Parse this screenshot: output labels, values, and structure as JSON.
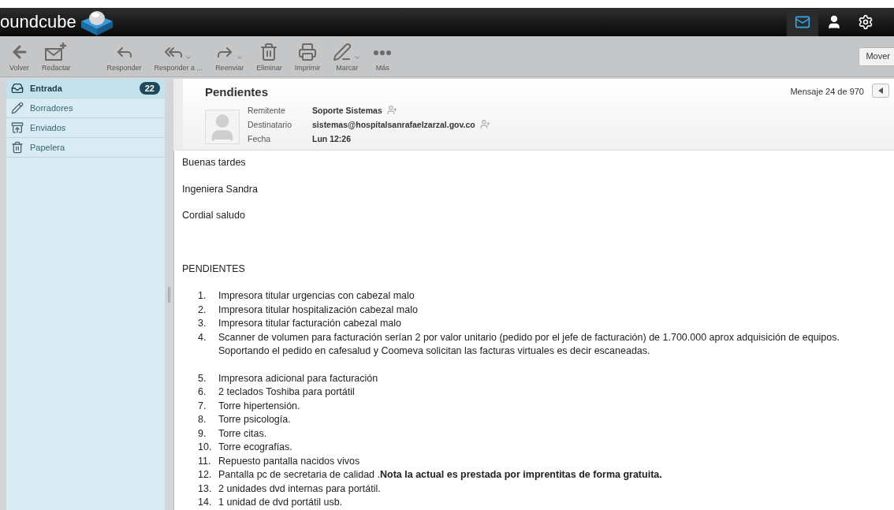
{
  "header": {
    "logo": "oundcube",
    "apps": [
      {
        "kind": "mail",
        "selected": true
      },
      {
        "kind": "contacts",
        "selected": false
      },
      {
        "kind": "settings",
        "selected": false
      }
    ]
  },
  "toolbar": {
    "buttons": [
      {
        "kind": "back",
        "label": "Volver",
        "menu": false
      },
      {
        "kind": "compose",
        "label": "Redactar",
        "menu": false
      },
      {
        "kind": "reply",
        "label": "Responder",
        "menu": false
      },
      {
        "kind": "reply-all",
        "label": "Responder a ...",
        "menu": true
      },
      {
        "kind": "forward",
        "label": "Reenviar",
        "menu": true
      },
      {
        "kind": "delete",
        "label": "Eliminar",
        "menu": false
      },
      {
        "kind": "print",
        "label": "Imprimir",
        "menu": false
      },
      {
        "kind": "mark",
        "label": "Marcar",
        "menu": true
      },
      {
        "kind": "more",
        "label": "Más",
        "menu": false
      }
    ],
    "move_button": "Mover"
  },
  "sidebar": {
    "folders": [
      {
        "kind": "inbox",
        "label": "Entrada",
        "count": "22",
        "selected": true
      },
      {
        "kind": "drafts",
        "label": "Borradores",
        "selected": false
      },
      {
        "kind": "sent",
        "label": "Enviados",
        "selected": false
      },
      {
        "kind": "trash",
        "label": "Papelera",
        "selected": false
      }
    ]
  },
  "message": {
    "subject": "Pendientes",
    "counter": "Mensaje 24 de 970",
    "fields": [
      {
        "label": "Remitente",
        "value": "Soporte Sistemas",
        "add_contact": true
      },
      {
        "label": "Destinatario",
        "value": "sistemas@hospitalsanrafaelzarzal.gov.co",
        "add_contact": true
      },
      {
        "label": "Fecha",
        "value": "Lun 12:26",
        "add_contact": false
      }
    ],
    "paragraphs": [
      "Buenas tardes",
      "Ingeniera Sandra",
      "Cordial saludo"
    ],
    "heading": "PENDIENTES",
    "list_1": [
      {
        "number": "1.",
        "text": "Impresora titular urgencias con cabezal malo"
      },
      {
        "number": "2.",
        "text": "Impresora titular hospitalización cabezal malo"
      },
      {
        "number": "3.",
        "text": "Impresora titular facturación cabezal malo"
      },
      {
        "number": "4.",
        "text": "Scanner de volumen para facturación serían 2 por valor unitario (pedido por el jefe de facturación) de 1.700.000 aprox adquisición de equipos. Soportando el pedido en cafesalud y Coomeva solicitan las facturas virtuales es decir escaneadas."
      }
    ],
    "list_2": [
      {
        "number": "5.",
        "text": "Impresora adicional para facturación"
      },
      {
        "number": "6.",
        "text": "2 teclados Toshiba para portátil"
      },
      {
        "number": "7.",
        "text": "Torre hipertensión."
      },
      {
        "number": "8.",
        "text": "Torre psicología."
      },
      {
        "number": "9.",
        "text": "Torre citas."
      },
      {
        "number": "10.",
        "text": "Torre ecografías."
      },
      {
        "number": "11.",
        "text": "Repuesto pantalla nacidos vivos"
      },
      {
        "number": "12.",
        "text": "Pantalla pc de secretaria de calidad .**Nota la actual es prestada por imprentitas de forma gratuita.**"
      },
      {
        "number": "13.",
        "text": "2 unidades dvd internas para portátil."
      },
      {
        "number": "14.",
        "text": "1 unidad de dvd portátil usb."
      }
    ]
  }
}
